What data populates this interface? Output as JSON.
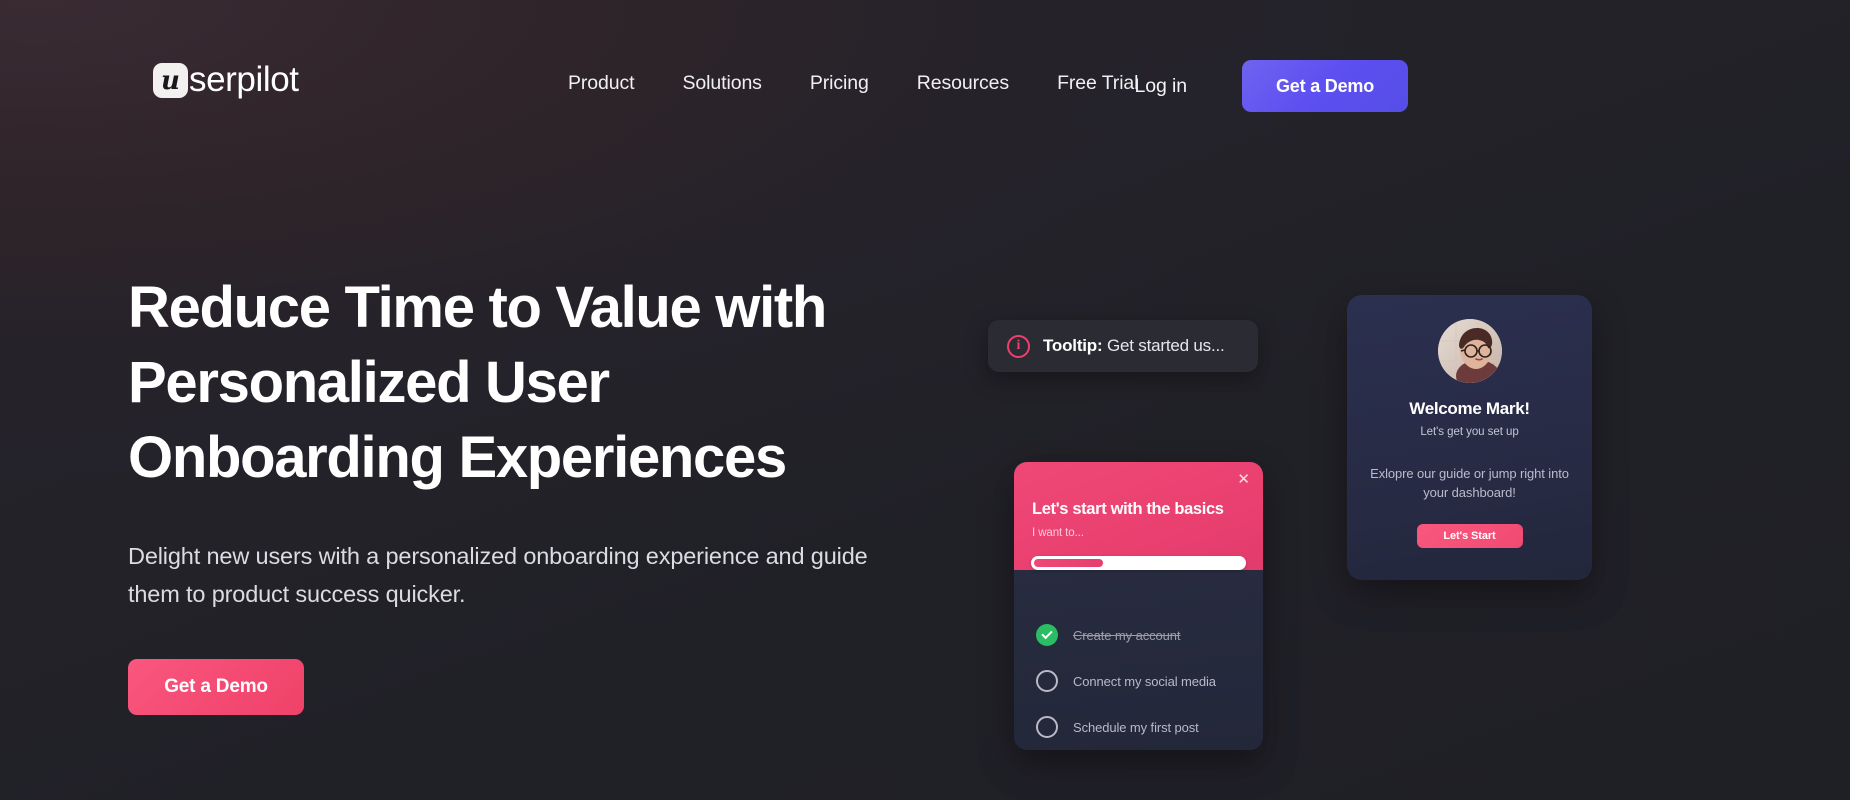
{
  "brand": {
    "logo_mark_letter": "u",
    "logo_text": "serpilot",
    "accent_purple": "#5d4ff0",
    "accent_pink": "#f44a72",
    "background": "#202027"
  },
  "header": {
    "nav": [
      {
        "label": "Product"
      },
      {
        "label": "Solutions"
      },
      {
        "label": "Pricing"
      },
      {
        "label": "Resources"
      },
      {
        "label": "Free Trial"
      }
    ],
    "login_label": "Log in",
    "demo_label": "Get a Demo"
  },
  "hero": {
    "title": "Reduce Time to Value with Personalized User Onboarding Experiences",
    "subtitle": "Delight new users with a personalized onboarding experience and guide them to product success quicker.",
    "cta_label": "Get a Demo"
  },
  "tooltip_card": {
    "icon": "info-icon",
    "label_bold": "Tooltip:",
    "label_rest": " Get started us..."
  },
  "checklist_card": {
    "close_icon": "close-icon",
    "title": "Let's start with the basics",
    "subtitle": "I want to...",
    "progress_percent": 33,
    "items": [
      {
        "label": "Create my account",
        "done": true
      },
      {
        "label": "Connect my social media",
        "done": false
      },
      {
        "label": "Schedule my first post",
        "done": false
      }
    ]
  },
  "welcome_card": {
    "avatar": "user-avatar-photo",
    "title": "Welcome Mark!",
    "subtitle": "Let's get you set up",
    "body": "Exlopre our guide or jump right into your dashboard!",
    "cta_label": "Let's Start"
  }
}
